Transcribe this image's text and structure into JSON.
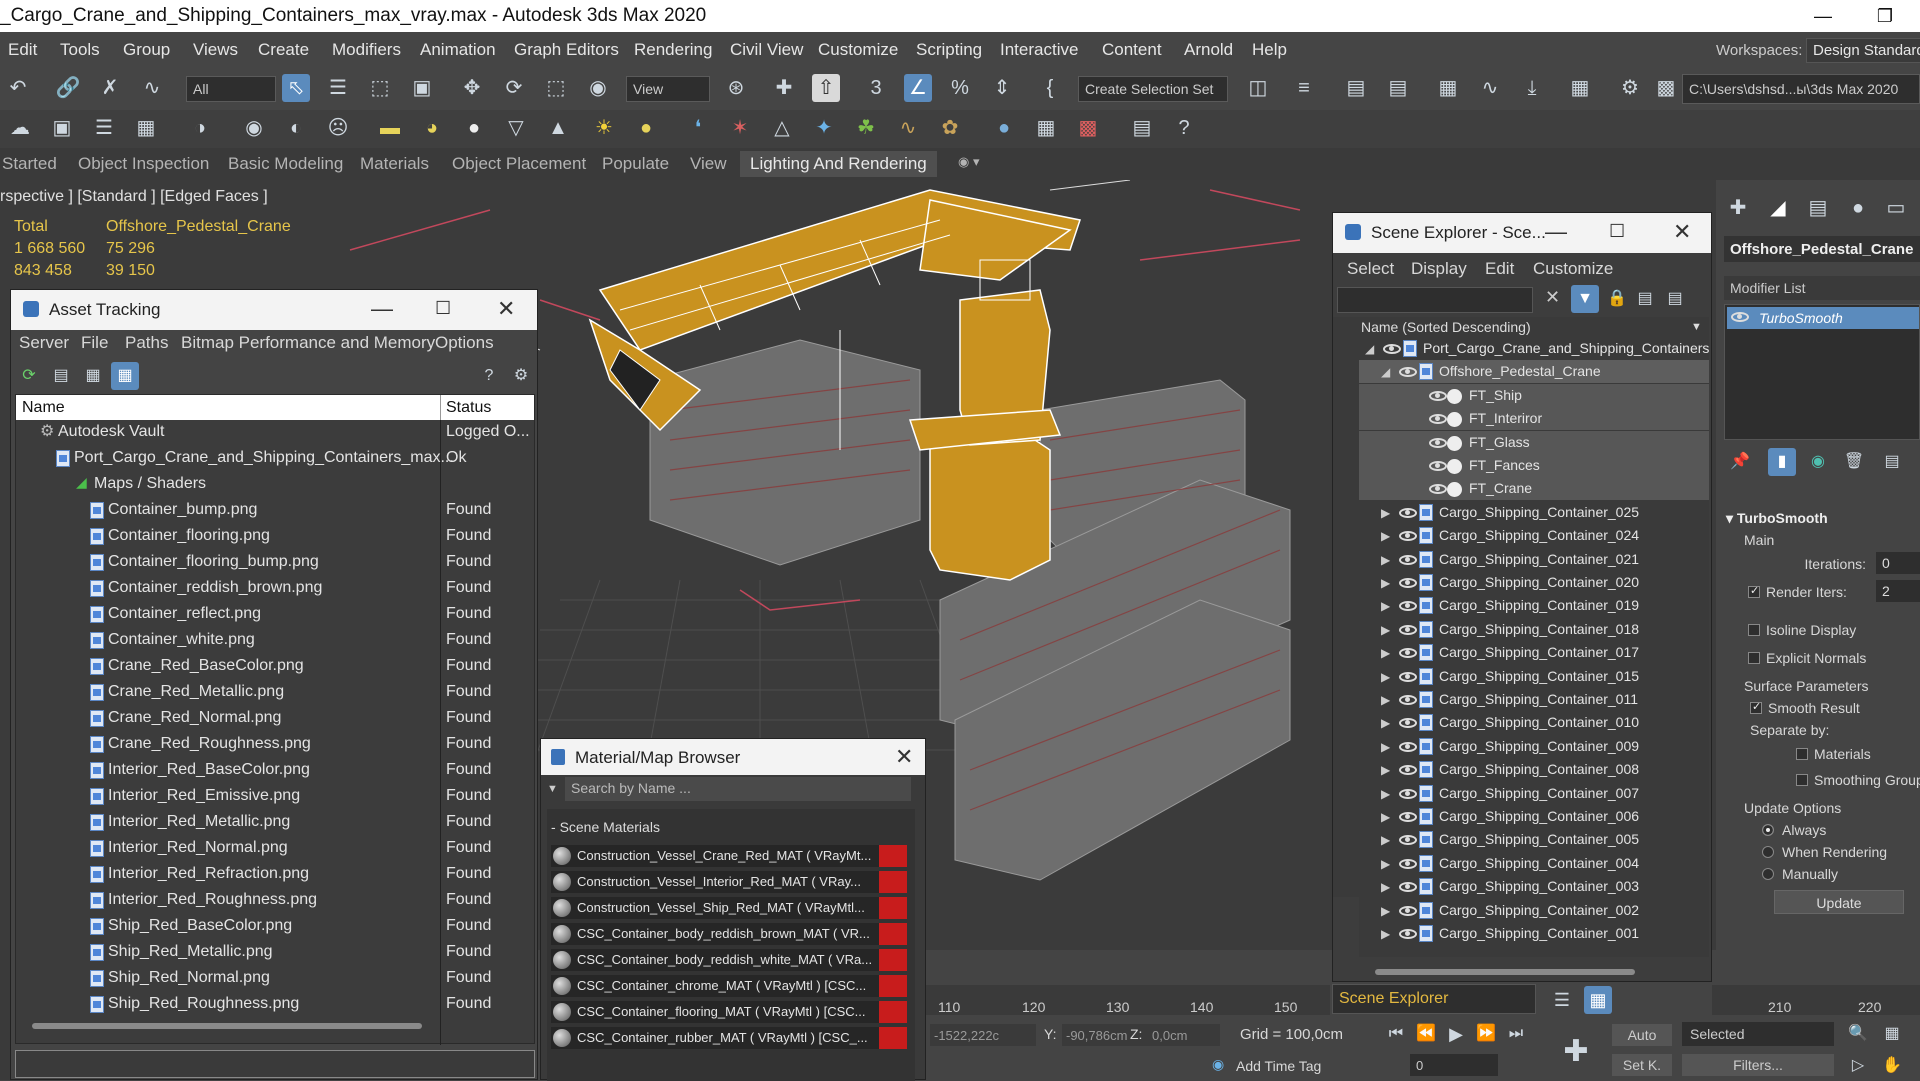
{
  "window": {
    "title": "_Cargo_Crane_and_Shipping_Containers_max_vray.max - Autodesk 3ds Max 2020"
  },
  "menu": [
    "Edit",
    "Tools",
    "Group",
    "Views",
    "Create",
    "Modifiers",
    "Animation",
    "Graph Editors",
    "Rendering",
    "Civil View",
    "Customize",
    "Scripting",
    "Interactive",
    "Content",
    "Arnold",
    "Help"
  ],
  "workspaces": {
    "label": "Workspaces:",
    "value": "Design Standard"
  },
  "toolbar": {
    "filter": "All",
    "ref_coord": "View",
    "selection_set": "Create Selection Set",
    "path": "C:\\Users\\dshsd...ы\\3ds Max 2020"
  },
  "ribbon": [
    "Started",
    "Object Inspection",
    "Basic Modeling",
    "Materials",
    "Object Placement",
    "Populate",
    "View",
    "Lighting And Rendering"
  ],
  "viewport": {
    "label": "rspective ] [Standard ] [Edged Faces ]",
    "stats": {
      "total_label": "Total",
      "object_name": "Offshore_Pedestal_Crane",
      "polys_total": "1 668 560",
      "polys_obj": "75 296",
      "verts_total": "843 458",
      "verts_obj": "39 150"
    }
  },
  "asset_tracking": {
    "title": "Asset Tracking",
    "menu": [
      "Server",
      "File",
      "Paths",
      "Bitmap Performance and Memory",
      "Options"
    ],
    "col_name": "Name",
    "col_status": "Status",
    "vault": {
      "name": "Autodesk Vault",
      "status": "Logged O..."
    },
    "file": {
      "name": "Port_Cargo_Crane_and_Shipping_Containers_max...",
      "status": "Ok"
    },
    "maps": "Maps / Shaders",
    "items": [
      {
        "name": "Container_bump.png",
        "status": "Found"
      },
      {
        "name": "Container_flooring.png",
        "status": "Found"
      },
      {
        "name": "Container_flooring_bump.png",
        "status": "Found"
      },
      {
        "name": "Container_reddish_brown.png",
        "status": "Found"
      },
      {
        "name": "Container_reflect.png",
        "status": "Found"
      },
      {
        "name": "Container_white.png",
        "status": "Found"
      },
      {
        "name": "Crane_Red_BaseColor.png",
        "status": "Found"
      },
      {
        "name": "Crane_Red_Metallic.png",
        "status": "Found"
      },
      {
        "name": "Crane_Red_Normal.png",
        "status": "Found"
      },
      {
        "name": "Crane_Red_Roughness.png",
        "status": "Found"
      },
      {
        "name": "Interior_Red_BaseColor.png",
        "status": "Found"
      },
      {
        "name": "Interior_Red_Emissive.png",
        "status": "Found"
      },
      {
        "name": "Interior_Red_Metallic.png",
        "status": "Found"
      },
      {
        "name": "Interior_Red_Normal.png",
        "status": "Found"
      },
      {
        "name": "Interior_Red_Refraction.png",
        "status": "Found"
      },
      {
        "name": "Interior_Red_Roughness.png",
        "status": "Found"
      },
      {
        "name": "Ship_Red_BaseColor.png",
        "status": "Found"
      },
      {
        "name": "Ship_Red_Metallic.png",
        "status": "Found"
      },
      {
        "name": "Ship_Red_Normal.png",
        "status": "Found"
      },
      {
        "name": "Ship_Red_Roughness.png",
        "status": "Found"
      }
    ]
  },
  "material_browser": {
    "title": "Material/Map Browser",
    "search_placeholder": "Search by Name ...",
    "section": "Scene Materials",
    "items": [
      "Construction_Vessel_Crane_Red_MAT  ( VRayMt...",
      "Construction_Vessel_Interior_Red_MAT  ( VRay...",
      "Construction_Vessel_Ship_Red_MAT  ( VRayMtl...",
      "CSC_Container_body_reddish_brown_MAT  ( VR...",
      "CSC_Container_body_reddish_white_MAT  ( VRa...",
      "CSC_Container_chrome_MAT  ( VRayMtl ) [CSC...",
      "CSC_Container_flooring_MAT  ( VRayMtl ) [CSC...",
      "CSC_Container_rubber_MAT  ( VRayMtl ) [CSC_..."
    ]
  },
  "scene_explorer": {
    "title": "Scene Explorer - Sce...",
    "menu": [
      "Select",
      "Display",
      "Edit",
      "Customize"
    ],
    "column": "Name (Sorted Descending)",
    "root": "Port_Cargo_Crane_and_Shipping_Containers",
    "crane": "Offshore_Pedestal_Crane",
    "children": [
      "FT_Ship",
      "FT_Interiror",
      "FT_Glass",
      "FT_Fances",
      "FT_Crane"
    ],
    "containers": [
      "Cargo_Shipping_Container_025",
      "Cargo_Shipping_Container_024",
      "Cargo_Shipping_Container_021",
      "Cargo_Shipping_Container_020",
      "Cargo_Shipping_Container_019",
      "Cargo_Shipping_Container_018",
      "Cargo_Shipping_Container_017",
      "Cargo_Shipping_Container_015",
      "Cargo_Shipping_Container_011",
      "Cargo_Shipping_Container_010",
      "Cargo_Shipping_Container_009",
      "Cargo_Shipping_Container_008",
      "Cargo_Shipping_Container_007",
      "Cargo_Shipping_Container_006",
      "Cargo_Shipping_Container_005",
      "Cargo_Shipping_Container_004",
      "Cargo_Shipping_Container_003",
      "Cargo_Shipping_Container_002",
      "Cargo_Shipping_Container_001"
    ],
    "footer": "Scene Explorer"
  },
  "command_panel": {
    "object_name": "Offshore_Pedestal_Crane",
    "modifier_list": "Modifier List",
    "modifier": "TurboSmooth",
    "rollout": "TurboSmooth",
    "main": "Main",
    "iterations_label": "Iterations:",
    "iterations": "0",
    "render_iters_label": "Render Iters:",
    "render_iters": "2",
    "isoline": "Isoline Display",
    "explicit_normals": "Explicit Normals",
    "surface": "Surface Parameters",
    "smooth_result": "Smooth Result",
    "separate_by": "Separate by:",
    "materials": "Materials",
    "smoothing_groups": "Smoothing Groups",
    "update_options": "Update Options",
    "always": "Always",
    "when_rendering": "When Rendering",
    "manually": "Manually",
    "update": "Update"
  },
  "timeline": {
    "ticks": [
      "110",
      "120",
      "130",
      "140",
      "150",
      "210",
      "220"
    ]
  },
  "status": {
    "x": "-1522,222c",
    "y_label": "Y:",
    "y": "-90,786cm",
    "z_label": "Z:",
    "z": "0,0cm",
    "grid": "Grid = 100,0cm",
    "auto": "Auto",
    "selected": "Selected",
    "setk": "Set K.",
    "filters": "Filters...",
    "frame": "0",
    "add_time_tag": "Add Time Tag"
  }
}
